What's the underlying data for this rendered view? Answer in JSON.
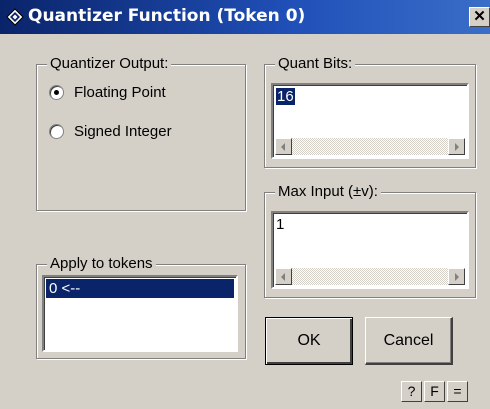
{
  "window": {
    "title": "Quantizer Function (Token 0)",
    "close_glyph": "✕"
  },
  "quantizer_output": {
    "legend": "Quantizer Output:",
    "options": [
      {
        "label": "Floating Point",
        "checked": true
      },
      {
        "label": "Signed Integer",
        "checked": false
      }
    ]
  },
  "quant_bits": {
    "legend": "Quant Bits:",
    "value": "16"
  },
  "max_input": {
    "legend": "Max Input (±v):",
    "value": "1"
  },
  "apply_tokens": {
    "legend": "Apply to tokens",
    "items": [
      "0 <--"
    ]
  },
  "buttons": {
    "ok": "OK",
    "cancel": "Cancel",
    "help": "?",
    "f": "F",
    "equals": "="
  }
}
